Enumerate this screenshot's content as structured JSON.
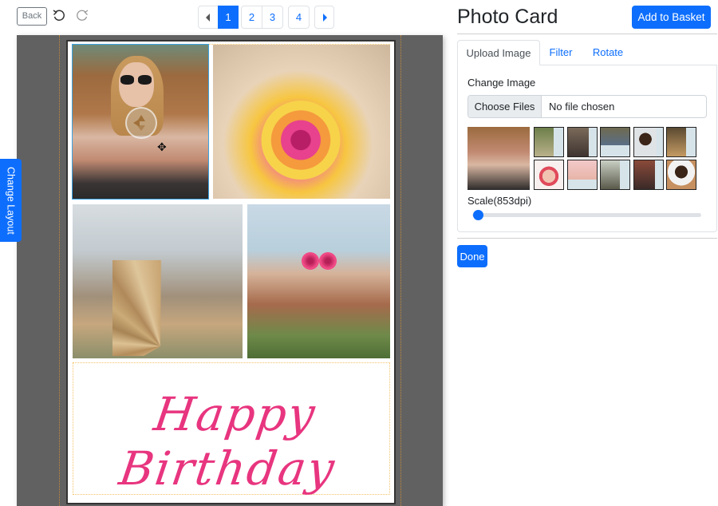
{
  "toolbar": {
    "back_label": "Back",
    "undo_icon": "undo-icon",
    "redo_icon": "redo-icon"
  },
  "pagination": {
    "prev_icon": "caret-left-icon",
    "next_icon": "caret-right-icon",
    "pages": [
      "1",
      "2",
      "3",
      "4"
    ],
    "active_page": "1"
  },
  "canvas": {
    "change_layout_label": "Change Layout",
    "greeting_text": "Happy Birthday",
    "greeting_color": "#e8357f",
    "photos": [
      {
        "description": "woman with sunglasses sitting",
        "selected": true
      },
      {
        "description": "woman holding flower bouquet",
        "selected": false
      },
      {
        "description": "dried palm fan in greenhouse",
        "selected": false
      },
      {
        "description": "woman holding flowers over eyes",
        "selected": false
      }
    ]
  },
  "panel": {
    "title": "Photo Card",
    "add_to_basket_label": "Add to Basket",
    "tabs": [
      {
        "label": "Upload Image",
        "active": true
      },
      {
        "label": "Filter",
        "active": false
      },
      {
        "label": "Rotate",
        "active": false
      }
    ],
    "change_image_label": "Change Image",
    "file_button_label": "Choose Files",
    "file_status": "No file chosen",
    "thumbnails_count": 10,
    "scale_label": "Scale(853dpi)",
    "scale_fraction": 0.01,
    "done_label": "Done"
  },
  "colors": {
    "accent": "#0d6efd",
    "workspace_bg": "#616161",
    "guide": "#f5c36b",
    "selection": "#3aa3e3"
  }
}
